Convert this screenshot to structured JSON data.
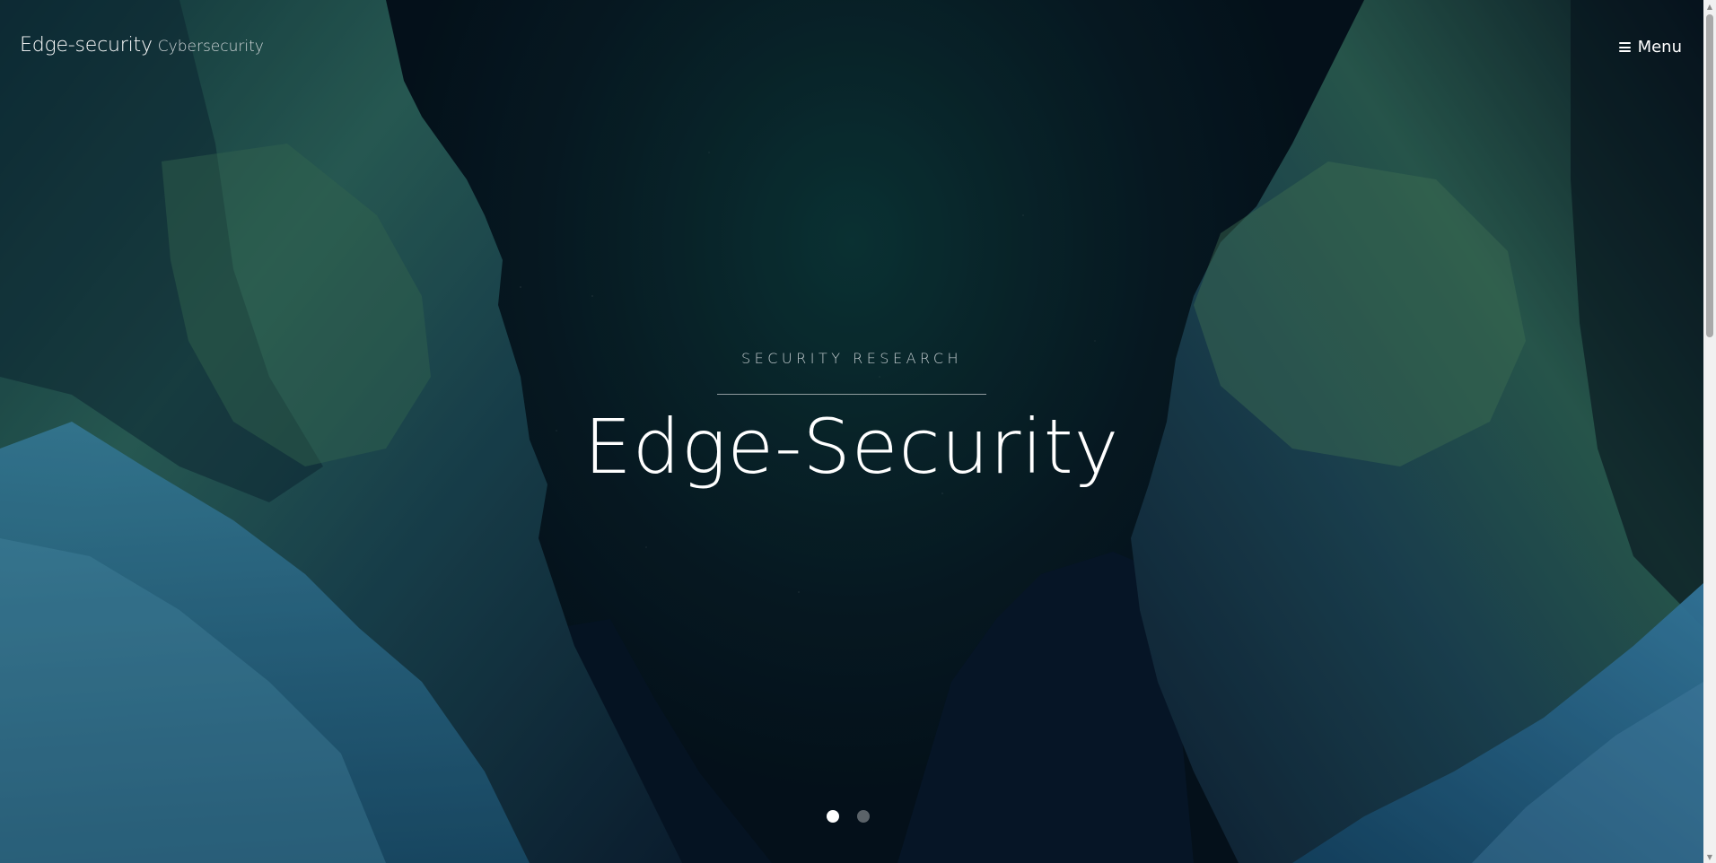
{
  "header": {
    "brand_name": "Edge-security",
    "brand_tagline": "Cybersecurity",
    "menu_label": "Menu",
    "menu_icon": "hamburger-icon"
  },
  "hero": {
    "kicker": "SECURITY RESEARCH",
    "title": "Edge-Security"
  },
  "slider": {
    "slide_count": 2,
    "active_index": 0
  },
  "colors": {
    "text": "#ffffff",
    "kicker": "#c4cdd0",
    "sky": "#0a2a2d"
  }
}
